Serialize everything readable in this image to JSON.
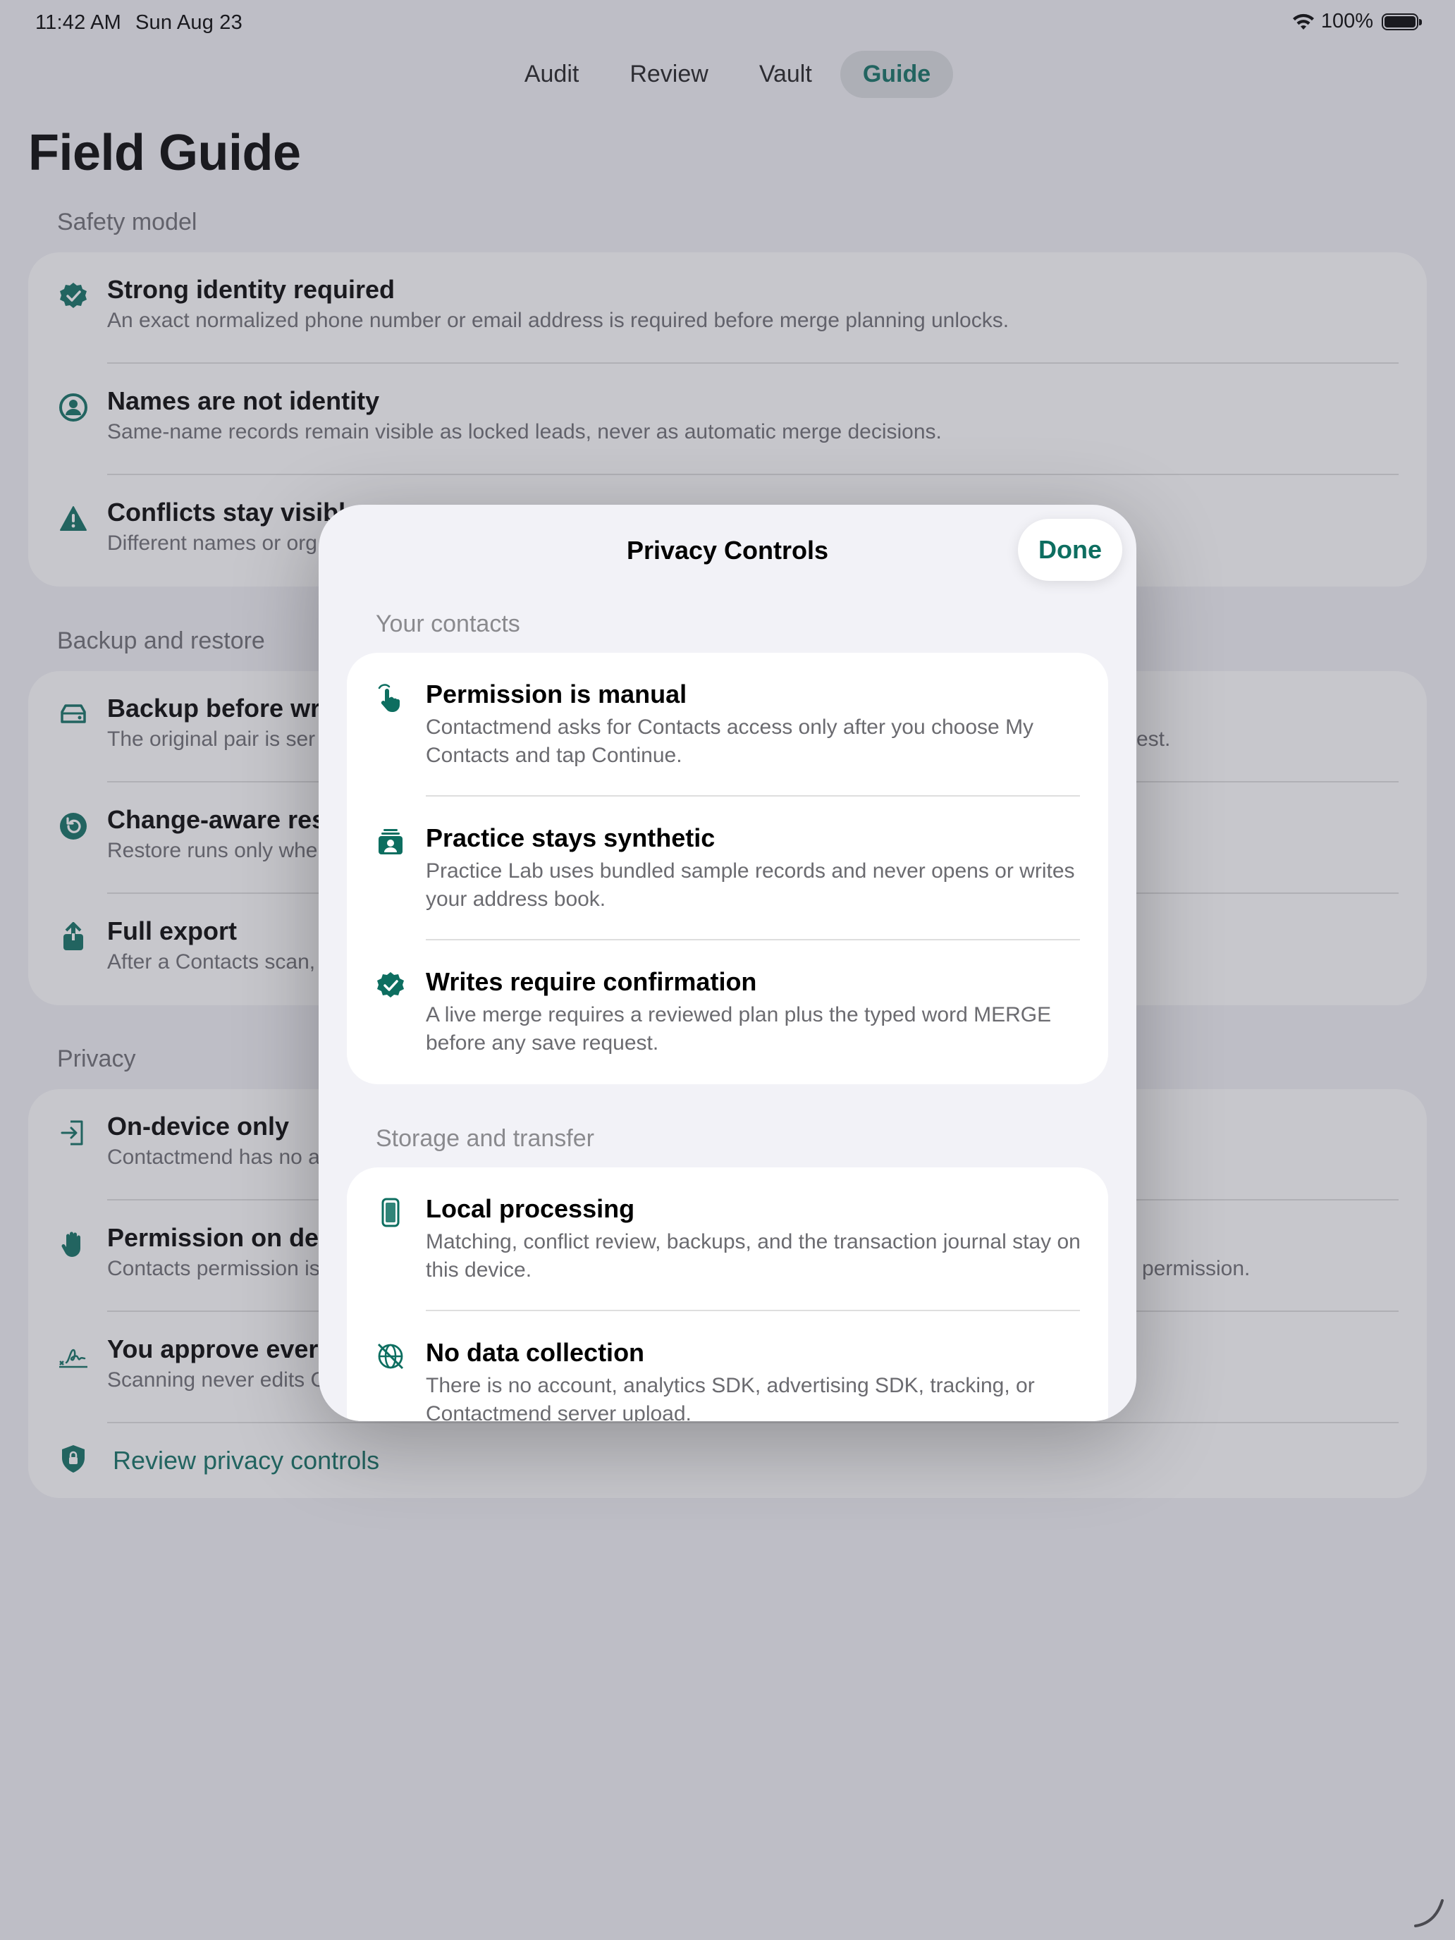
{
  "status": {
    "time": "11:42 AM",
    "date": "Sun Aug 23",
    "battery": "100%"
  },
  "tabs": [
    {
      "label": "Audit"
    },
    {
      "label": "Review"
    },
    {
      "label": "Vault"
    },
    {
      "label": "Guide"
    }
  ],
  "page_title": "Field Guide",
  "sections": [
    {
      "header": "Safety model",
      "items": [
        {
          "icon": "checkmark-seal-icon",
          "title": "Strong identity required",
          "desc": "An exact normalized phone number or email address is required before merge planning unlocks."
        },
        {
          "icon": "person-circle-icon",
          "title": "Names are not identity",
          "desc": "Same-name records remain visible as locked leads, never as automatic merge decisions."
        },
        {
          "icon": "warning-triangle-icon",
          "title": "Conflicts stay visible",
          "desc": "Different names or org"
        }
      ]
    },
    {
      "header": "Backup and restore",
      "items": [
        {
          "icon": "external-drive-icon",
          "title": "Backup before writ",
          "desc": "The original pair is ser",
          "desc_right": "est."
        },
        {
          "icon": "restore-arrow-icon",
          "title": "Change-aware rest",
          "desc": "Restore runs only whe"
        },
        {
          "icon": "share-export-icon",
          "title": "Full export",
          "desc": "After a Contacts scan,"
        }
      ]
    },
    {
      "header": "Privacy",
      "items": [
        {
          "icon": "arrow-into-device-icon",
          "title": "On-device only",
          "desc": "Contactmend has no a"
        },
        {
          "icon": "raised-hand-icon",
          "title": "Permission on dem",
          "desc": "Contacts permission is",
          "desc_right": "permission."
        },
        {
          "icon": "signature-icon",
          "title": "You approve every",
          "desc": "Scanning never edits C"
        }
      ],
      "link": {
        "icon": "lock-shield-icon",
        "label": "Review privacy controls"
      }
    }
  ],
  "modal": {
    "title": "Privacy Controls",
    "done_label": "Done",
    "sections": [
      {
        "header": "Your contacts",
        "items": [
          {
            "icon": "hand-tap-icon",
            "title": "Permission is manual",
            "desc": "Contactmend asks for Contacts access only after you choose My Contacts and tap Continue."
          },
          {
            "icon": "person-stack-icon",
            "title": "Practice stays synthetic",
            "desc": "Practice Lab uses bundled sample records and never opens or writes your address book."
          },
          {
            "icon": "checkmark-seal-icon",
            "title": "Writes require confirmation",
            "desc": "A live merge requires a reviewed plan plus the typed word MERGE before any save request."
          }
        ]
      },
      {
        "header": "Storage and transfer",
        "items": [
          {
            "icon": "phone-device-icon",
            "title": "Local processing",
            "desc": "Matching, conflict review, backups, and the transaction journal stay on this device."
          },
          {
            "icon": "no-network-globe-icon",
            "title": "No data collection",
            "desc": "There is no account, analytics SDK, advertising SDK, tracking, or Contactmend server upload."
          }
        ]
      }
    ]
  },
  "colors": {
    "accent": "#0d6e60",
    "background": "#f2f2f7",
    "secondary_text": "#6b6b70"
  }
}
